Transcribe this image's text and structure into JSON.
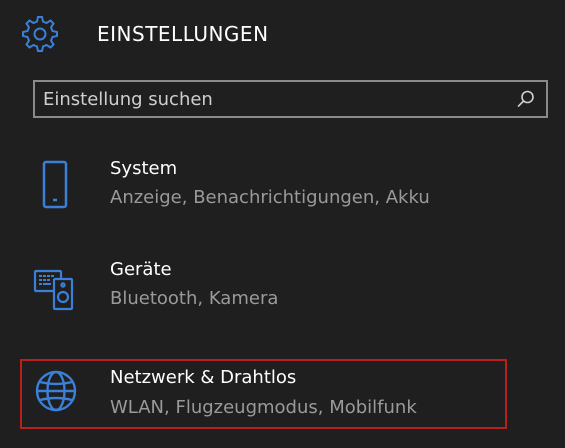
{
  "header": {
    "title": "EINSTELLUNGEN",
    "icon": "gear-icon"
  },
  "search": {
    "placeholder": "Einstellung suchen",
    "value": "",
    "icon": "search-icon"
  },
  "items": [
    {
      "title": "System",
      "subtitle": "Anzeige, Benachrichtigungen, Akku",
      "icon": "phone-icon"
    },
    {
      "title": "Geräte",
      "subtitle": "Bluetooth, Kamera",
      "icon": "devices-icon"
    },
    {
      "title": "Netzwerk & Drahtlos",
      "subtitle": "WLAN, Flugzeugmodus, Mobilfunk",
      "icon": "globe-icon",
      "highlighted": true
    }
  ],
  "colors": {
    "background": "#1f1f1f",
    "accent": "#3a7fd8",
    "highlight_border": "#b81f1f",
    "subtitle_text": "#9a9a9a"
  }
}
